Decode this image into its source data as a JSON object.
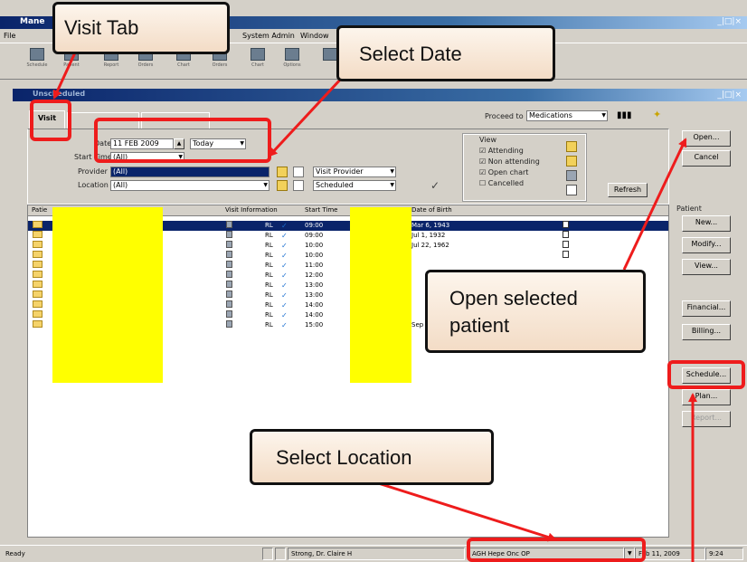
{
  "app": {
    "title": "Mane",
    "window_controls": "_|□|×",
    "menu": [
      "File",
      "System Admin",
      "Window"
    ],
    "toolbar": [
      {
        "icon": "toolbar-icon",
        "label": "Schedule"
      },
      {
        "icon": "toolbar-icon",
        "label": "Patient"
      },
      {
        "icon": "toolbar-icon",
        "label": "Report"
      },
      {
        "icon": "toolbar-icon",
        "label": "Orders"
      },
      {
        "icon": "toolbar-icon",
        "label": "Chart"
      },
      {
        "icon": "toolbar-icon",
        "label": "Orders"
      },
      {
        "icon": "toolbar-icon",
        "label": "Chart"
      },
      {
        "icon": "toolbar-icon",
        "label": "Options"
      },
      {
        "icon": "toolbar-icon",
        "label": ""
      }
    ]
  },
  "subwindow": {
    "title": "Unscheduled",
    "controls": "_|□|×"
  },
  "tabs": {
    "visit": "Visit",
    "tab2": "",
    "tab3": ""
  },
  "filters": {
    "date_label": "Date",
    "date_value": "11 FEB 2009",
    "today_option": "Today",
    "start_time_label": "Start Time",
    "start_time_value": "(All)",
    "provider_label": "Provider",
    "provider_value": "(All)",
    "location_label": "Location",
    "location_value": "(All)",
    "visit_provider_value": "Visit Provider",
    "scheduled_value": "Scheduled",
    "proceed_label": "Proceed to",
    "proceed_value": "Medications",
    "view_label": "View",
    "view_options": [
      {
        "label": "Attending",
        "checked": true
      },
      {
        "label": "Non attending",
        "checked": true
      },
      {
        "label": "Open chart",
        "checked": true
      },
      {
        "label": "Cancelled",
        "checked": false
      }
    ],
    "refresh_label": "Refresh"
  },
  "grid": {
    "headers": [
      "Patie",
      "Visit Information",
      "Start Time",
      "Date of Birth"
    ],
    "rows": [
      {
        "prov": "RL",
        "time": "09:00",
        "dob": "Mar 6, 1943",
        "selected": true
      },
      {
        "prov": "RL",
        "time": "09:00",
        "dob": "Jul 1, 1932",
        "selected": false
      },
      {
        "prov": "RL",
        "time": "10:00",
        "dob": "Jul 22, 1962",
        "selected": false
      },
      {
        "prov": "RL",
        "time": "10:00",
        "dob": "",
        "selected": false
      },
      {
        "prov": "RL",
        "time": "11:00",
        "dob": "",
        "selected": false
      },
      {
        "prov": "RL",
        "time": "12:00",
        "dob": "",
        "selected": false
      },
      {
        "prov": "RL",
        "time": "13:00",
        "dob": "",
        "selected": false
      },
      {
        "prov": "RL",
        "time": "13:00",
        "dob": "",
        "selected": false
      },
      {
        "prov": "RL",
        "time": "14:00",
        "dob": "",
        "selected": false
      },
      {
        "prov": "RL",
        "time": "14:00",
        "dob": "",
        "selected": false
      },
      {
        "prov": "RL",
        "time": "15:00",
        "dob": "Sep 14, 1993",
        "selected": false
      }
    ]
  },
  "right_panel": {
    "open": "Open...",
    "cancel": "Cancel",
    "patient_group": "Patient",
    "new": "New...",
    "modify": "Modify...",
    "view": "View...",
    "financial": "Financial...",
    "billing": "Billing...",
    "schedule": "Schedule...",
    "plan": "Plan...",
    "disabled": "Report..."
  },
  "status_bar": {
    "ready": "Ready",
    "user": "Strong, Dr. Claire H",
    "location": "AGH Hepe Onc OP",
    "date": "Feb 11, 2009",
    "time": "9:24"
  },
  "callouts": {
    "visit_tab": "Visit Tab",
    "select_date": "Select Date",
    "open_patient_line1": "Open selected",
    "open_patient_line2": "patient",
    "select_location": "Select Location"
  },
  "colors": {
    "annotation_red": "#ee1c1c",
    "callout_fill": "#f3dcc6",
    "redaction": "#ffff00",
    "selection": "#0a246a"
  }
}
